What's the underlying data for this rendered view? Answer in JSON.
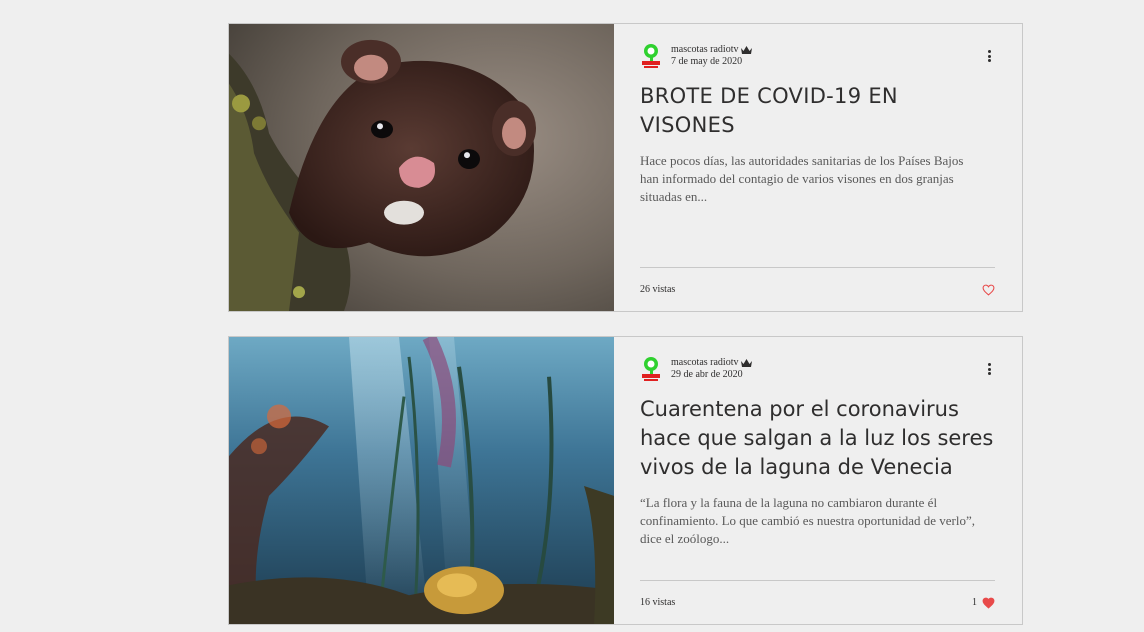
{
  "posts": [
    {
      "author": "mascotas radiotv",
      "date": "7 de may de 2020",
      "title": "BROTE DE COVID-19 EN VISONES",
      "excerpt": "Hace pocos días, las autoridades sanitarias de los Países Bajos han informado del contagio de varios visones en dos granjas situadas en...",
      "views": "26 vistas",
      "likes": "",
      "liked": false,
      "image": "mink photo"
    },
    {
      "author": "mascotas radiotv",
      "date": "29 de abr de 2020",
      "title": "Cuarentena por el coronavirus hace que salgan a la luz los seres vivos de la laguna de Venecia",
      "excerpt": "“La flora y la fauna de la laguna no cambiaron durante él confinamiento. Lo que cambió es nuestra oportunidad de verlo”, dice el zoólogo...",
      "views": "16 vistas",
      "likes": "1",
      "liked": true,
      "image": "underwater lagoon photo"
    }
  ],
  "icons": {
    "avatar": "radio-logo-icon",
    "admin": "crown-icon",
    "menu": "more-options-icon",
    "like": "heart-icon"
  },
  "colors": {
    "heart": "#e84a4a",
    "logo_green": "#2fd12f",
    "logo_red": "#e02020"
  }
}
